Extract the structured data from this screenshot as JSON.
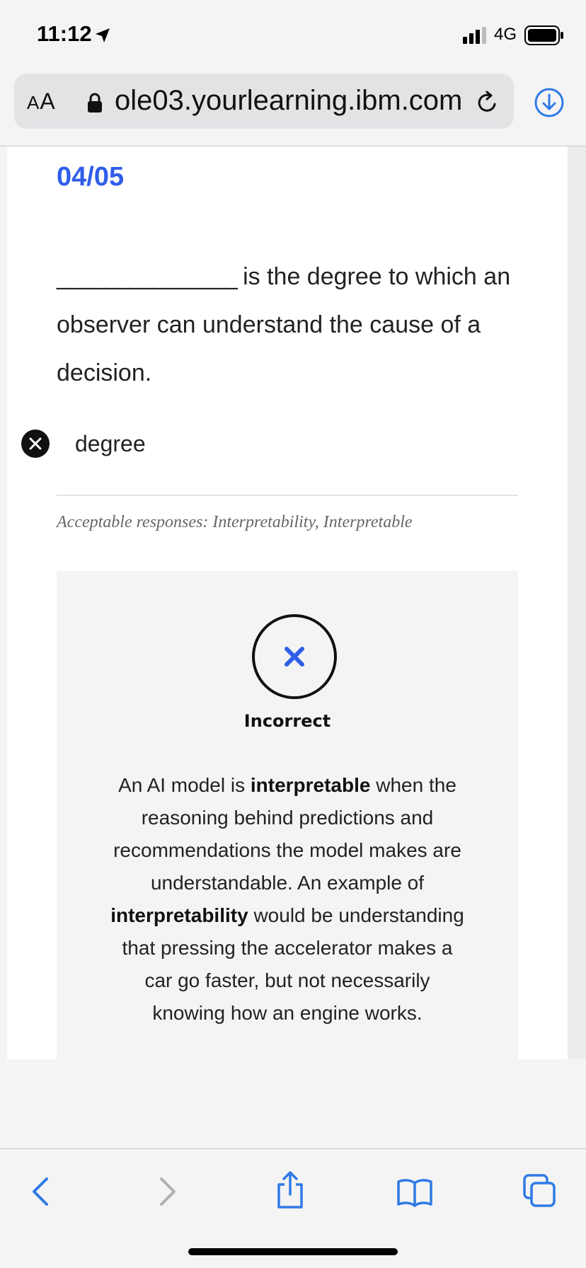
{
  "status_bar": {
    "time": "11:12",
    "network": "4G",
    "icons": [
      "location-arrow-icon",
      "signal-icon",
      "battery-icon"
    ]
  },
  "browser": {
    "aa_label_big": "A",
    "aa_label_small": "A",
    "url": "ole03.yourlearning.ibm.com",
    "icons": [
      "lock-icon",
      "reload-icon",
      "download-icon"
    ],
    "accent_color": "#2f5ee8"
  },
  "quiz": {
    "counter": "04/05",
    "question_blank": "_______________",
    "question_text": " is the degree to which an observer can understand the cause of a decision.",
    "answer": "degree",
    "acceptable": "Acceptable responses: Interpretability, Interpretable"
  },
  "feedback": {
    "status": "Incorrect",
    "text_1": "An AI model is ",
    "bold_1": "interpretable",
    "text_2": " when the reasoning behind predictions and recommendations the model makes are understandable. An example of ",
    "bold_2": "interpretability",
    "text_3": " would be understanding that pressing the accelerator makes a car go faster, but not necessarily knowing how an engine works."
  },
  "toolbar": {
    "icons": [
      "back-icon",
      "forward-icon",
      "share-icon",
      "bookmarks-icon",
      "tabs-icon"
    ]
  }
}
